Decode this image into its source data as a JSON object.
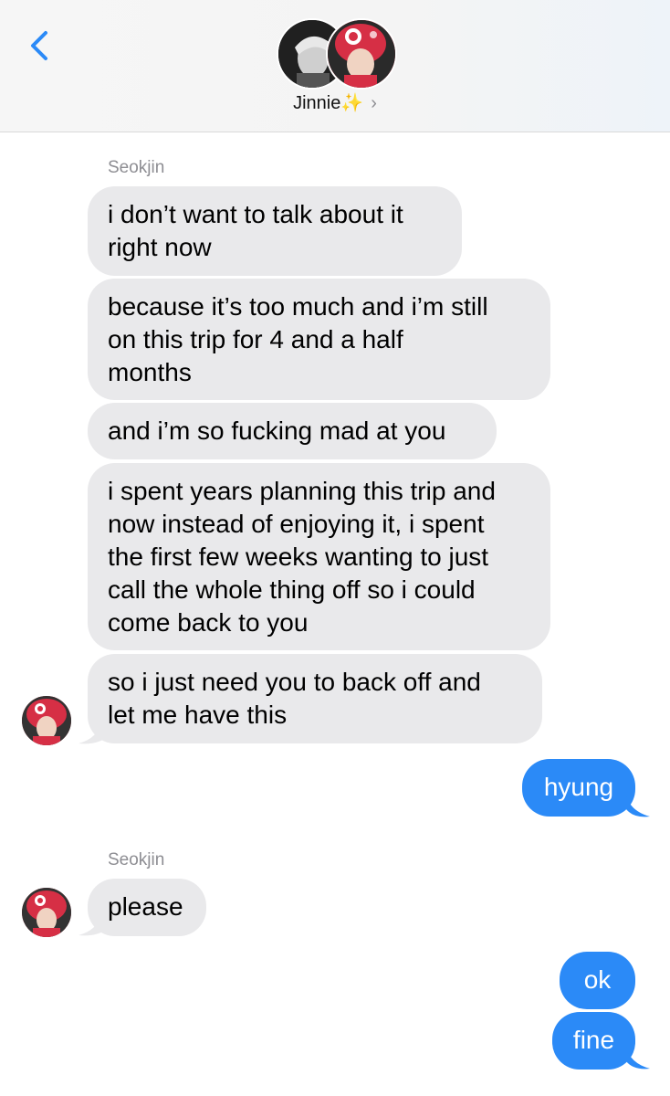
{
  "header": {
    "contact_name": "Jinnie",
    "contact_emoji": "✨",
    "chevron": "›",
    "back_icon": "chevron-left-icon"
  },
  "colors": {
    "accent": "#2b8af7",
    "incoming_bubble": "#e9e9eb",
    "secondary_text": "#8e8e93"
  },
  "messages": {
    "sender_1": "Seokjin",
    "m1": "i don’t want to talk about it\nright now",
    "m2": "because it’s too much and i’m still\non this trip for 4 and a half\nmonths",
    "m3": "and i’m so fucking mad at you",
    "m4": "i spent years planning this trip and\nnow instead of enjoying it, i spent\nthe first few weeks wanting to just\ncall the whole thing off so i could\ncome back to you",
    "m5": "so i just need you to back off and\nlet me have this",
    "m6": "hyung",
    "sender_2": "Seokjin",
    "m7": "please",
    "m8": "ok",
    "m9": "fine"
  }
}
